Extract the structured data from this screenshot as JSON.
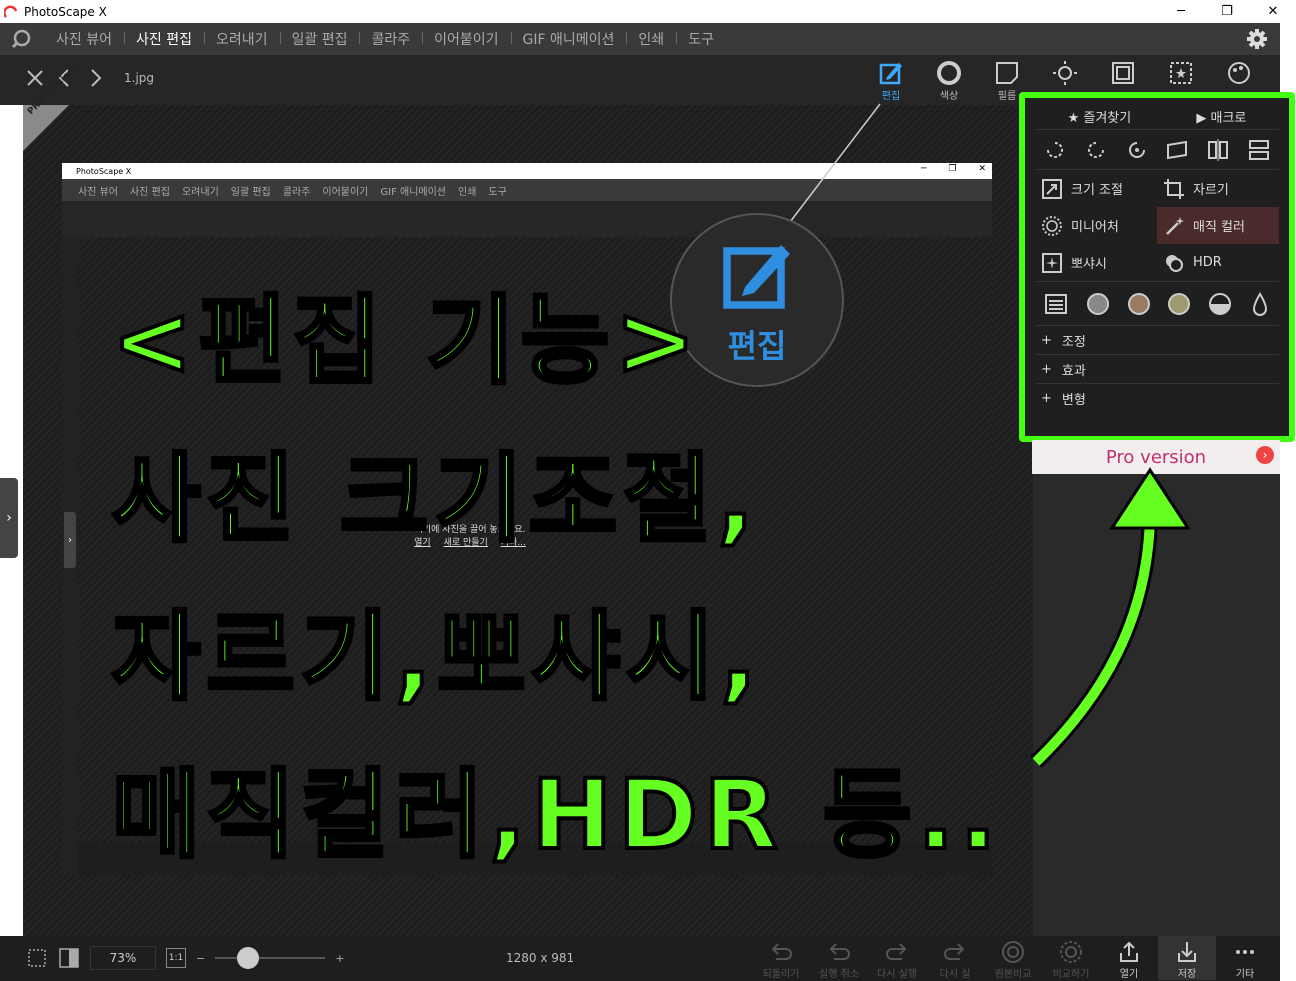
{
  "window": {
    "title": "PhotoScape X",
    "minimize": "─",
    "maximize": "❐",
    "close": "✕"
  },
  "menu": {
    "items": [
      "사진 뷰어",
      "사진 편집",
      "오려내기",
      "일괄 편집",
      "콜라주",
      "이어붙이기",
      "GIF 애니메이션",
      "인쇄",
      "도구"
    ],
    "active": "사진 편집"
  },
  "toolbar": {
    "filename": "1.jpg",
    "tools": [
      {
        "label": "편집",
        "icon": "edit-icon",
        "active": true
      },
      {
        "label": "색상",
        "icon": "color-icon"
      },
      {
        "label": "필름",
        "icon": "film-icon"
      },
      {
        "label": "",
        "icon": "light-icon"
      },
      {
        "label": "",
        "icon": "frame-icon"
      },
      {
        "label": "",
        "icon": "insert-icon"
      },
      {
        "label": "",
        "icon": "tools-icon"
      }
    ]
  },
  "pro_badge": "PRO Version",
  "inner": {
    "title": "PhotoScape X",
    "menu": [
      "사진 뷰어",
      "사진 편집",
      "오려내기",
      "일괄 편집",
      "콜라주",
      "이어붙이기",
      "GIF 애니메이션",
      "인쇄",
      "도구"
    ],
    "drop_text": "여기에 사진을 끌어 놓으세요.",
    "links": [
      "열기",
      "새로 만들기",
      "기타..."
    ]
  },
  "magnifier": {
    "label": "편집"
  },
  "overlay": {
    "lines": [
      "<편집 기능>",
      "사진 크기조절,",
      "자르기,뽀샤시,",
      "매직컬러,HDR 등.."
    ]
  },
  "popup": {
    "favorites": "즐겨찾기",
    "macro": "매크로",
    "items": [
      {
        "label": "크기 조절",
        "icon": "resize-icon"
      },
      {
        "label": "자르기",
        "icon": "crop-icon"
      },
      {
        "label": "미니어처",
        "icon": "miniature-icon"
      },
      {
        "label": "매직 컬러",
        "icon": "magic-wand-icon",
        "highlight": true
      },
      {
        "label": "뽀샤시",
        "icon": "bloom-icon"
      },
      {
        "label": "HDR",
        "icon": "hdr-icon"
      }
    ],
    "sections": [
      "조정",
      "효과",
      "변형"
    ]
  },
  "banner": {
    "text": "Pro version"
  },
  "bottom": {
    "zoom": "73%",
    "one_to_one": "1:1",
    "dimensions": "1280 x 981",
    "actions": [
      {
        "label": "되돌리기",
        "icon": "revert-icon"
      },
      {
        "label": "실행 취소",
        "icon": "undo-icon"
      },
      {
        "label": "다시 실행",
        "icon": "redo-icon"
      },
      {
        "label": "다시 실",
        "icon": "redo-all-icon"
      },
      {
        "label": "원본비교",
        "icon": "compare-icon"
      },
      {
        "label": "비교하기",
        "icon": "compare2-icon"
      },
      {
        "label": "열기",
        "icon": "share-icon",
        "on": true
      },
      {
        "label": "저장",
        "icon": "save-icon",
        "on": true,
        "selected": true
      },
      {
        "label": "기타",
        "icon": "more-icon",
        "on": true
      }
    ]
  },
  "colors": {
    "accent_green": "#44ff11",
    "accent_blue": "#3ea8ff"
  }
}
